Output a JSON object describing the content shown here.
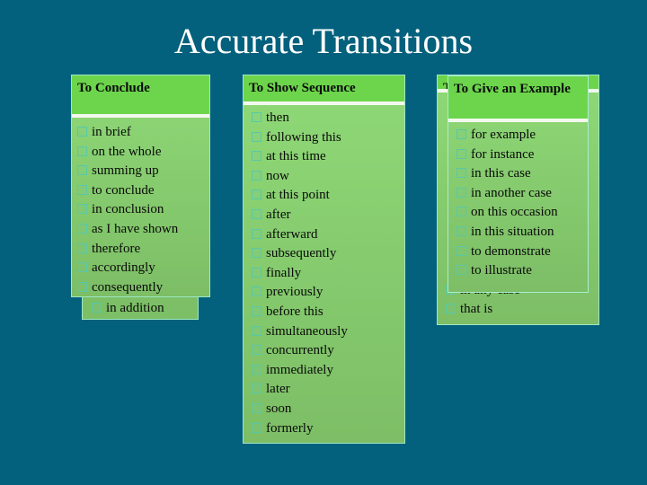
{
  "slide": {
    "title": "Accurate Transitions"
  },
  "panels": {
    "conclude": {
      "heading": "To Conclude",
      "items": [
        "in brief",
        "on the whole",
        "summing up",
        "to conclude",
        "in conclusion",
        "as I have shown",
        "therefore",
        "accordingly",
        "consequently"
      ]
    },
    "addition": {
      "items": [
        "in addition"
      ]
    },
    "sequence": {
      "heading": "To Show Sequence",
      "items": [
        "then",
        "following this",
        "at this time",
        "now",
        "at this point",
        "after",
        "afterward",
        "subsequently",
        "finally",
        "previously",
        "before this",
        "simultaneously",
        "concurrently",
        "immediately",
        "later",
        "soon",
        "formerly"
      ]
    },
    "back": {
      "heading": "T",
      "items": [
        "in any case",
        "that is"
      ]
    },
    "example": {
      "heading": "To Give an Example",
      "items": [
        "for example",
        "for instance",
        "in this case",
        "in another case",
        "on this occasion",
        "in this situation",
        "to demonstrate",
        "to illustrate"
      ]
    }
  },
  "icons": {
    "bullet": "checkbox-bullet-icon"
  },
  "colors": {
    "background": "#03617d",
    "panel_header": "#6cd54c",
    "panel_body": "#8fd977",
    "bullet_border": "#58c9a8"
  }
}
